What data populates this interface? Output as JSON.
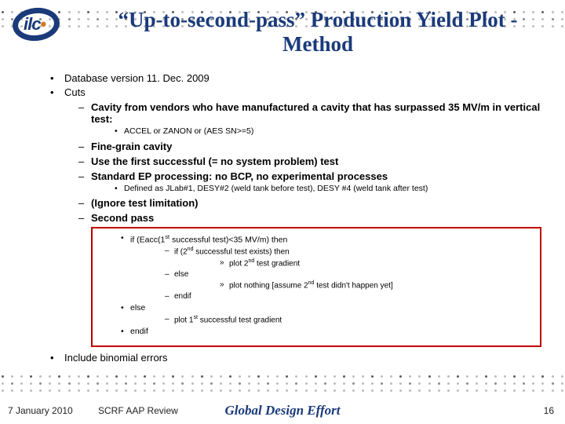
{
  "logo": {
    "text": "ilc"
  },
  "title": "“Up-to-second-pass” Production Yield Plot - Method",
  "b1": "Database version 11. Dec. 2009",
  "b2": "Cuts",
  "c1": "Cavity from vendors who have manufactured a cavity that has surpassed 35 MV/m in vertical test:",
  "c1a": "ACCEL or ZANON or (AES SN>=5)",
  "c2": "Fine-grain cavity",
  "c3": "Use the first successful (= no system problem) test",
  "c4": "Standard EP processing: no BCP, no experimental processes",
  "c4a": "Defined as JLab#1, DESY#2 (weld tank before test), DESY #4 (weld tank after test)",
  "c5": "(Ignore test limitation)",
  "c6": "Second pass",
  "s1": "if (Eacc(1",
  "s1b": " successful test)<35 MV/m) then",
  "s1_1": "if (2",
  "s1_1b": " successful test exists) then",
  "s1_1a": "plot 2",
  "s1_1ab": " test gradient",
  "s1_2": "else",
  "s1_2a_a": "plot nothing [assume 2",
  "s1_2a_b": " test didn't happen yet]",
  "s1_3": "endif",
  "s2": "else",
  "s2a_a": "plot 1",
  "s2a_b": " successful test gradient",
  "s3": "endif",
  "b3": "Include binomial errors",
  "footer": {
    "date": "7 January 2010",
    "review": "SCRF AAP Review",
    "center": "Global Design Effort",
    "page": "16"
  }
}
